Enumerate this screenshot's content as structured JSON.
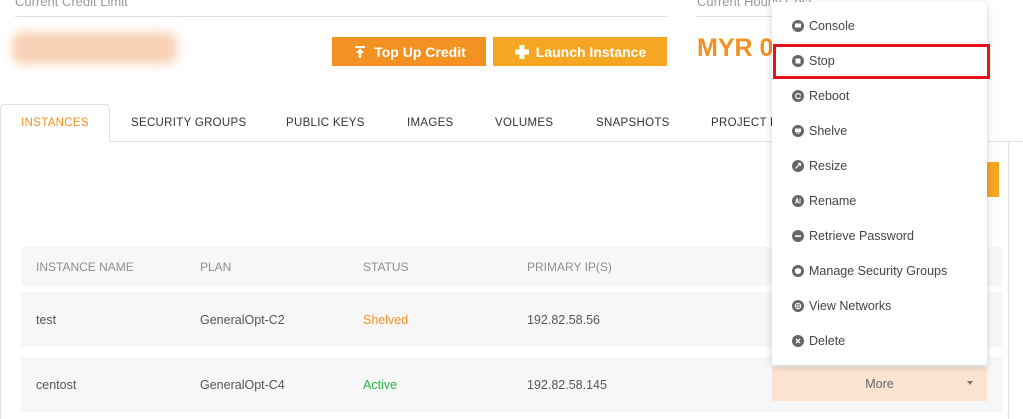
{
  "credit": {
    "label": "Current Credit Limit"
  },
  "hourly": {
    "label": "Current Hourly Cost",
    "amount_prefix": "MYR 0"
  },
  "buttons": {
    "top_up": "Top Up Credit",
    "launch": "Launch Instance"
  },
  "tabs": [
    "INSTANCES",
    "SECURITY GROUPS",
    "PUBLIC KEYS",
    "IMAGES",
    "VOLUMES",
    "SNAPSHOTS",
    "PROJECT L"
  ],
  "table": {
    "headers": [
      "INSTANCE NAME",
      "PLAN",
      "STATUS",
      "PRIMARY IP(S)"
    ],
    "rows": [
      {
        "name": "test",
        "plan": "GeneralOpt-C2",
        "status": "Shelved",
        "ip": "192.82.58.56"
      },
      {
        "name": "centost",
        "plan": "GeneralOpt-C4",
        "status": "Active",
        "ip": "192.82.58.145"
      }
    ]
  },
  "status_colors": {
    "Shelved": "#f39122",
    "Active": "#2fb344"
  },
  "accent_color": "#f39122",
  "more_label": "More",
  "menu": [
    {
      "label": "Console",
      "icon": "console-icon"
    },
    {
      "label": "Stop",
      "icon": "stop-icon"
    },
    {
      "label": "Reboot",
      "icon": "reboot-icon"
    },
    {
      "label": "Shelve",
      "icon": "shelve-icon"
    },
    {
      "label": "Resize",
      "icon": "resize-icon"
    },
    {
      "label": "Rename",
      "icon": "rename-icon"
    },
    {
      "label": "Retrieve Password",
      "icon": "password-icon"
    },
    {
      "label": "Manage Security Groups",
      "icon": "security-groups-icon"
    },
    {
      "label": "View Networks",
      "icon": "networks-icon"
    },
    {
      "label": "Delete",
      "icon": "delete-icon"
    }
  ],
  "highlighted_menu_item": "Stop"
}
